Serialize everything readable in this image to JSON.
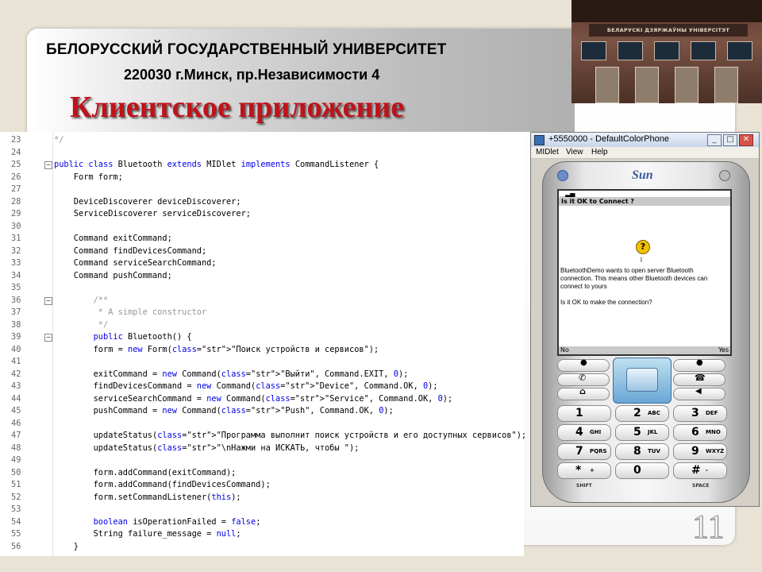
{
  "slide": {
    "university": "БЕЛОРУССКИЙ ГОСУДАРСТВЕННЫЙ УНИВЕРСИТЕТ",
    "address": "220030 г.Минск, пр.Независимости 4",
    "heading": "Клиентское приложение",
    "page_number": "11",
    "photo_sign": "БЕЛАРУСКІ ДЗЯРЖАЎНЫ УНІВЕРСІТЭТ"
  },
  "code_lines": [
    {
      "n": "23",
      "t": "*/"
    },
    {
      "n": "24",
      "t": ""
    },
    {
      "n": "25",
      "t": "public class Bluetooth extends MIDlet implements CommandListener {"
    },
    {
      "n": "26",
      "t": "    Form form;"
    },
    {
      "n": "27",
      "t": ""
    },
    {
      "n": "28",
      "t": "    DeviceDiscoverer deviceDiscoverer;"
    },
    {
      "n": "29",
      "t": "    ServiceDiscoverer serviceDiscoverer;"
    },
    {
      "n": "30",
      "t": ""
    },
    {
      "n": "31",
      "t": "    Command exitCommand;"
    },
    {
      "n": "32",
      "t": "    Command findDevicesCommand;"
    },
    {
      "n": "33",
      "t": "    Command serviceSearchCommand;"
    },
    {
      "n": "34",
      "t": "    Command pushCommand;"
    },
    {
      "n": "35",
      "t": ""
    },
    {
      "n": "36",
      "t": "        /**"
    },
    {
      "n": "37",
      "t": "         * A simple constructor"
    },
    {
      "n": "38",
      "t": "         */"
    },
    {
      "n": "39",
      "t": "        public Bluetooth() {"
    },
    {
      "n": "40",
      "t": "        form = new Form(\"Поиск устройств и сервисов\");"
    },
    {
      "n": "41",
      "t": ""
    },
    {
      "n": "42",
      "t": "        exitCommand = new Command(\"Выйти\", Command.EXIT, 0);"
    },
    {
      "n": "43",
      "t": "        findDevicesCommand = new Command(\"Device\", Command.OK, 0);"
    },
    {
      "n": "44",
      "t": "        serviceSearchCommand = new Command(\"Service\", Command.OK, 0);"
    },
    {
      "n": "45",
      "t": "        pushCommand = new Command(\"Push\", Command.OK, 0);"
    },
    {
      "n": "46",
      "t": ""
    },
    {
      "n": "47",
      "t": "        updateStatus(\"Программа выполнит поиск устройств и его доступных сервисов\");"
    },
    {
      "n": "48",
      "t": "        updateStatus(\"\\nНажми на ИСКАТЬ, чтобы \");"
    },
    {
      "n": "49",
      "t": ""
    },
    {
      "n": "50",
      "t": "        form.addCommand(exitCommand);"
    },
    {
      "n": "51",
      "t": "        form.addCommand(findDevicesCommand);"
    },
    {
      "n": "52",
      "t": "        form.setCommandListener(this);"
    },
    {
      "n": "53",
      "t": ""
    },
    {
      "n": "54",
      "t": "        boolean isOperationFailed = false;"
    },
    {
      "n": "55",
      "t": "        String failure_message = null;"
    },
    {
      "n": "56",
      "t": "    }"
    }
  ],
  "emulator": {
    "title": "+5550000 - DefaultColorPhone",
    "menu": [
      "MIDlet",
      "View",
      "Help"
    ],
    "brand": "Sun",
    "screen_header": "Is it OK to Connect ?",
    "screen_message": "BluetoothDemo wants to open server Bluetooth connection. This means other Bluetooth devices can connect to yours",
    "screen_question": "Is it OK to make the connection?",
    "soft_left": "No",
    "soft_right": "Yes",
    "keys": [
      {
        "n": "1",
        "l": ""
      },
      {
        "n": "2",
        "l": "ABC"
      },
      {
        "n": "3",
        "l": "DEF"
      },
      {
        "n": "4",
        "l": "GHI"
      },
      {
        "n": "5",
        "l": "JKL"
      },
      {
        "n": "6",
        "l": "MNO"
      },
      {
        "n": "7",
        "l": "PQRS"
      },
      {
        "n": "8",
        "l": "TUV"
      },
      {
        "n": "9",
        "l": "WXYZ"
      },
      {
        "n": "*",
        "l": "+"
      },
      {
        "n": "0",
        "l": ""
      },
      {
        "n": "#",
        "l": "-"
      }
    ],
    "shift_label": "SHIFT",
    "space_label": "SPACE"
  }
}
